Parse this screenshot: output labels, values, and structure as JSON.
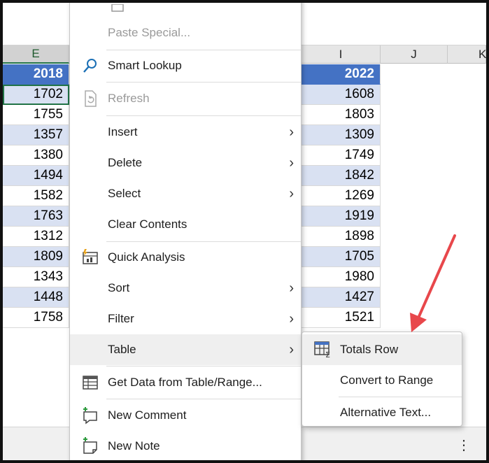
{
  "columns": {
    "e": "E",
    "i": "I",
    "j": "J",
    "k": "K"
  },
  "col_e": {
    "header": "2018",
    "values": [
      "1702",
      "1755",
      "1357",
      "1380",
      "1494",
      "1582",
      "1763",
      "1312",
      "1809",
      "1343",
      "1448",
      "1758"
    ]
  },
  "col_i": {
    "header": "2022",
    "values": [
      "1608",
      "1803",
      "1309",
      "1749",
      "1842",
      "1269",
      "1919",
      "1898",
      "1705",
      "1980",
      "1427",
      "1521"
    ]
  },
  "menu": {
    "paste_special": "Paste Special...",
    "smart_lookup": "Smart Lookup",
    "refresh": "Refresh",
    "insert": "Insert",
    "delete": "Delete",
    "select": "Select",
    "clear_contents": "Clear Contents",
    "quick_analysis": "Quick Analysis",
    "sort": "Sort",
    "filter": "Filter",
    "table": "Table",
    "get_data": "Get Data from Table/Range...",
    "new_comment": "New Comment",
    "new_note": "New Note"
  },
  "submenu": {
    "totals_row": "Totals Row",
    "convert_to_range": "Convert to Range",
    "alternative_text": "Alternative Text..."
  },
  "icons": {
    "smart_lookup": "magnifier-icon",
    "refresh": "refresh-icon",
    "quick_analysis": "quick-analysis-icon",
    "get_data": "table-data-icon",
    "new_comment": "comment-icon",
    "new_note": "note-icon",
    "totals_row": "totals-row-icon",
    "more": "more-vertical-icon",
    "arrow": "red-arrow-annotation"
  },
  "colors": {
    "header_blue": "#4472c4",
    "band_blue": "#d9e1f2",
    "arrow_red": "#e8474b"
  }
}
